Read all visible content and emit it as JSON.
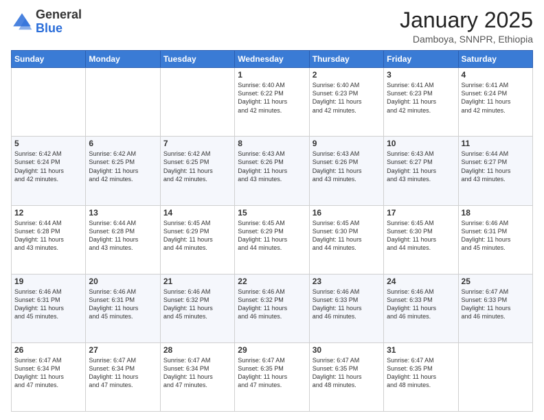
{
  "header": {
    "logo_general": "General",
    "logo_blue": "Blue",
    "month_title": "January 2025",
    "location": "Damboya, SNNPR, Ethiopia"
  },
  "days_of_week": [
    "Sunday",
    "Monday",
    "Tuesday",
    "Wednesday",
    "Thursday",
    "Friday",
    "Saturday"
  ],
  "weeks": [
    [
      {
        "day": "",
        "info": ""
      },
      {
        "day": "",
        "info": ""
      },
      {
        "day": "",
        "info": ""
      },
      {
        "day": "1",
        "info": "Sunrise: 6:40 AM\nSunset: 6:22 PM\nDaylight: 11 hours\nand 42 minutes."
      },
      {
        "day": "2",
        "info": "Sunrise: 6:40 AM\nSunset: 6:23 PM\nDaylight: 11 hours\nand 42 minutes."
      },
      {
        "day": "3",
        "info": "Sunrise: 6:41 AM\nSunset: 6:23 PM\nDaylight: 11 hours\nand 42 minutes."
      },
      {
        "day": "4",
        "info": "Sunrise: 6:41 AM\nSunset: 6:24 PM\nDaylight: 11 hours\nand 42 minutes."
      }
    ],
    [
      {
        "day": "5",
        "info": "Sunrise: 6:42 AM\nSunset: 6:24 PM\nDaylight: 11 hours\nand 42 minutes."
      },
      {
        "day": "6",
        "info": "Sunrise: 6:42 AM\nSunset: 6:25 PM\nDaylight: 11 hours\nand 42 minutes."
      },
      {
        "day": "7",
        "info": "Sunrise: 6:42 AM\nSunset: 6:25 PM\nDaylight: 11 hours\nand 42 minutes."
      },
      {
        "day": "8",
        "info": "Sunrise: 6:43 AM\nSunset: 6:26 PM\nDaylight: 11 hours\nand 43 minutes."
      },
      {
        "day": "9",
        "info": "Sunrise: 6:43 AM\nSunset: 6:26 PM\nDaylight: 11 hours\nand 43 minutes."
      },
      {
        "day": "10",
        "info": "Sunrise: 6:43 AM\nSunset: 6:27 PM\nDaylight: 11 hours\nand 43 minutes."
      },
      {
        "day": "11",
        "info": "Sunrise: 6:44 AM\nSunset: 6:27 PM\nDaylight: 11 hours\nand 43 minutes."
      }
    ],
    [
      {
        "day": "12",
        "info": "Sunrise: 6:44 AM\nSunset: 6:28 PM\nDaylight: 11 hours\nand 43 minutes."
      },
      {
        "day": "13",
        "info": "Sunrise: 6:44 AM\nSunset: 6:28 PM\nDaylight: 11 hours\nand 43 minutes."
      },
      {
        "day": "14",
        "info": "Sunrise: 6:45 AM\nSunset: 6:29 PM\nDaylight: 11 hours\nand 44 minutes."
      },
      {
        "day": "15",
        "info": "Sunrise: 6:45 AM\nSunset: 6:29 PM\nDaylight: 11 hours\nand 44 minutes."
      },
      {
        "day": "16",
        "info": "Sunrise: 6:45 AM\nSunset: 6:30 PM\nDaylight: 11 hours\nand 44 minutes."
      },
      {
        "day": "17",
        "info": "Sunrise: 6:45 AM\nSunset: 6:30 PM\nDaylight: 11 hours\nand 44 minutes."
      },
      {
        "day": "18",
        "info": "Sunrise: 6:46 AM\nSunset: 6:31 PM\nDaylight: 11 hours\nand 45 minutes."
      }
    ],
    [
      {
        "day": "19",
        "info": "Sunrise: 6:46 AM\nSunset: 6:31 PM\nDaylight: 11 hours\nand 45 minutes."
      },
      {
        "day": "20",
        "info": "Sunrise: 6:46 AM\nSunset: 6:31 PM\nDaylight: 11 hours\nand 45 minutes."
      },
      {
        "day": "21",
        "info": "Sunrise: 6:46 AM\nSunset: 6:32 PM\nDaylight: 11 hours\nand 45 minutes."
      },
      {
        "day": "22",
        "info": "Sunrise: 6:46 AM\nSunset: 6:32 PM\nDaylight: 11 hours\nand 46 minutes."
      },
      {
        "day": "23",
        "info": "Sunrise: 6:46 AM\nSunset: 6:33 PM\nDaylight: 11 hours\nand 46 minutes."
      },
      {
        "day": "24",
        "info": "Sunrise: 6:46 AM\nSunset: 6:33 PM\nDaylight: 11 hours\nand 46 minutes."
      },
      {
        "day": "25",
        "info": "Sunrise: 6:47 AM\nSunset: 6:33 PM\nDaylight: 11 hours\nand 46 minutes."
      }
    ],
    [
      {
        "day": "26",
        "info": "Sunrise: 6:47 AM\nSunset: 6:34 PM\nDaylight: 11 hours\nand 47 minutes."
      },
      {
        "day": "27",
        "info": "Sunrise: 6:47 AM\nSunset: 6:34 PM\nDaylight: 11 hours\nand 47 minutes."
      },
      {
        "day": "28",
        "info": "Sunrise: 6:47 AM\nSunset: 6:34 PM\nDaylight: 11 hours\nand 47 minutes."
      },
      {
        "day": "29",
        "info": "Sunrise: 6:47 AM\nSunset: 6:35 PM\nDaylight: 11 hours\nand 47 minutes."
      },
      {
        "day": "30",
        "info": "Sunrise: 6:47 AM\nSunset: 6:35 PM\nDaylight: 11 hours\nand 48 minutes."
      },
      {
        "day": "31",
        "info": "Sunrise: 6:47 AM\nSunset: 6:35 PM\nDaylight: 11 hours\nand 48 minutes."
      },
      {
        "day": "",
        "info": ""
      }
    ]
  ]
}
